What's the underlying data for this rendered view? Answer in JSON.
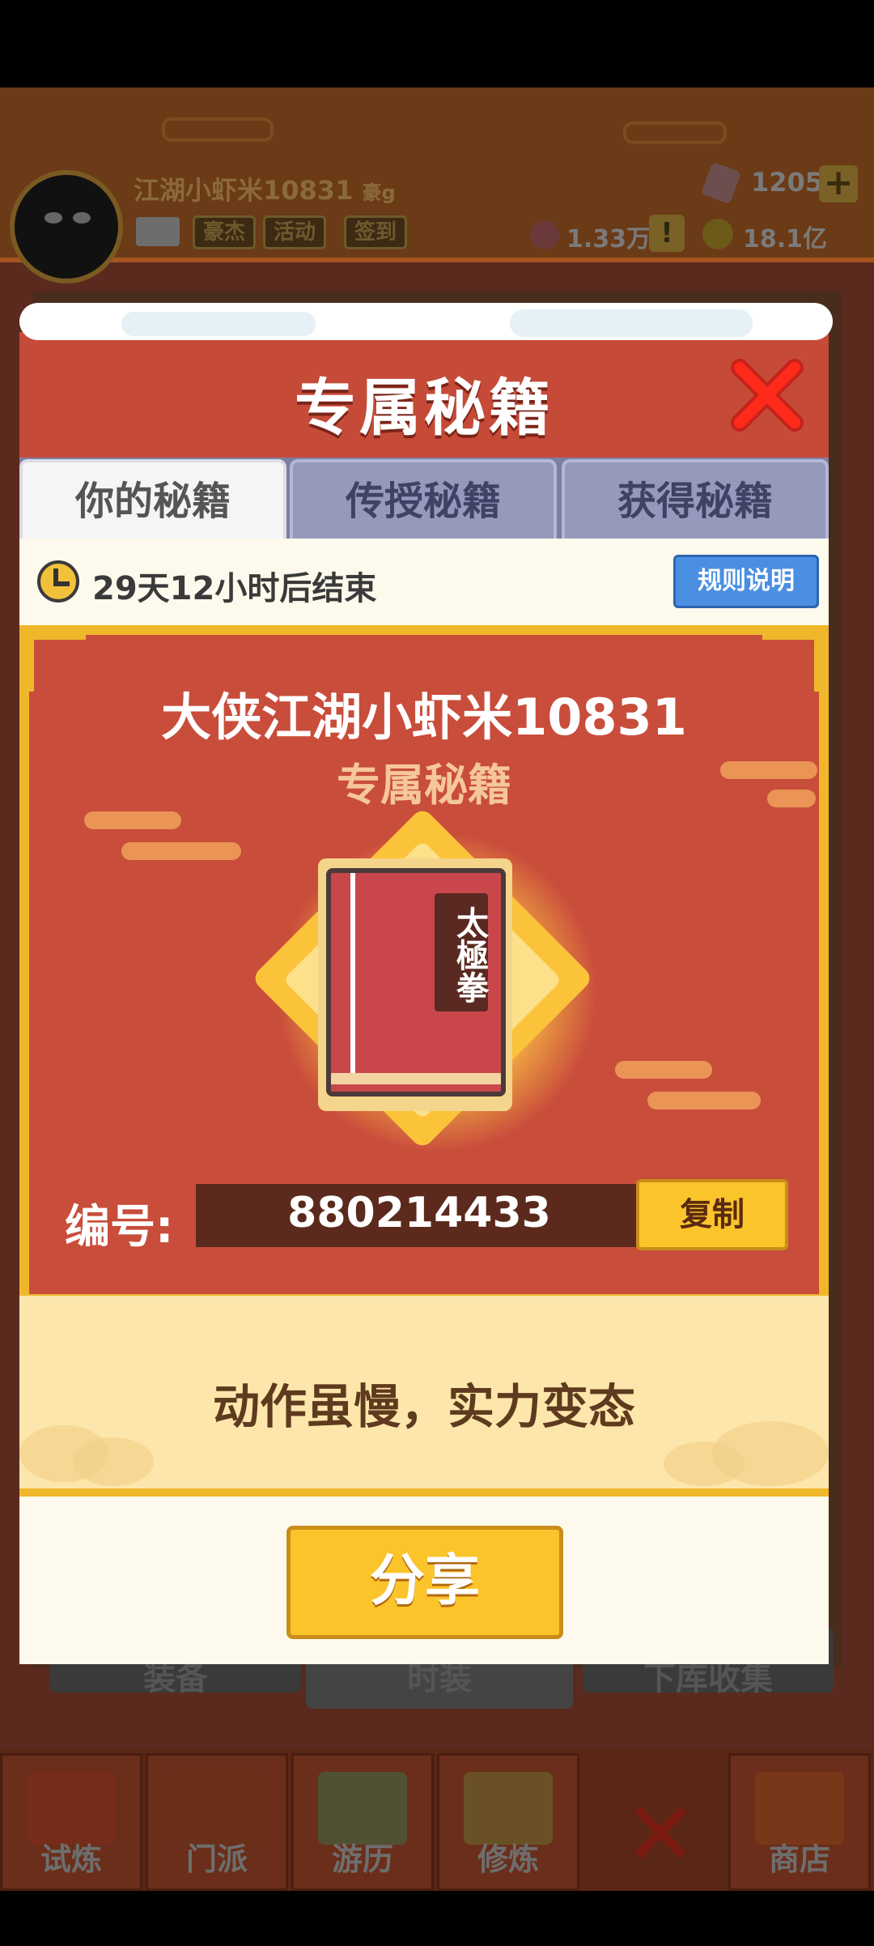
{
  "player": {
    "name": "江湖小虾米10831",
    "tag": "豪g",
    "buttons": [
      "豪杰",
      "活动",
      "签到"
    ],
    "gems": "1205",
    "gem_add": "+",
    "tickets": "1.33万",
    "ticket_alert": "!",
    "coins": "18.1亿"
  },
  "background_tabs": [
    "装备",
    "时装",
    "下库收集"
  ],
  "bottom_nav": [
    "试炼",
    "门派",
    "游历",
    "修炼",
    "商店"
  ],
  "modal": {
    "title": "专属秘籍",
    "tabs": [
      "你的秘籍",
      "传授秘籍",
      "获得秘籍"
    ],
    "timer_text": "29天12小时后结束",
    "rules_label": "规则说明",
    "hero_line": "大侠江湖小虾米10831",
    "subtitle": "专属秘籍",
    "book_title": "太極拳",
    "code_label": "编号:",
    "code_value": "880214433",
    "copy_label": "复制",
    "slogan": "动作虽慢，实力变态",
    "share_label": "分享"
  },
  "colors": {
    "header_red": "#c64a38",
    "gold": "#f0b72a",
    "blue_button": "#4a8fe2",
    "tab_inactive": "#959abd"
  }
}
